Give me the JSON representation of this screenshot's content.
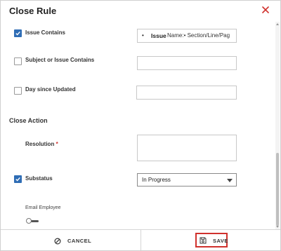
{
  "dialog": {
    "title": "Close Rule"
  },
  "rules": [
    {
      "label": "Issue Contains",
      "checked": true
    },
    {
      "label": "Subject or Issue Contains",
      "checked": false
    },
    {
      "label": "Day since Updated",
      "checked": false
    }
  ],
  "issue_contains": {
    "bullet": "•",
    "bold": "Issue",
    "rest": "Name:•    Section/Line/Pag"
  },
  "close_action": {
    "heading": "Close Action",
    "resolution_label": "Resolution",
    "required_mark": "*",
    "substatus_label": "Substatus",
    "substatus_checked": true,
    "substatus_value": "In Progress",
    "email_label": "Email Employee",
    "email_enabled": false
  },
  "footer": {
    "cancel_label": "CANCEL",
    "save_label": "SAVE"
  },
  "colors": {
    "accent": "#2f6db5",
    "danger": "#d0312d"
  }
}
